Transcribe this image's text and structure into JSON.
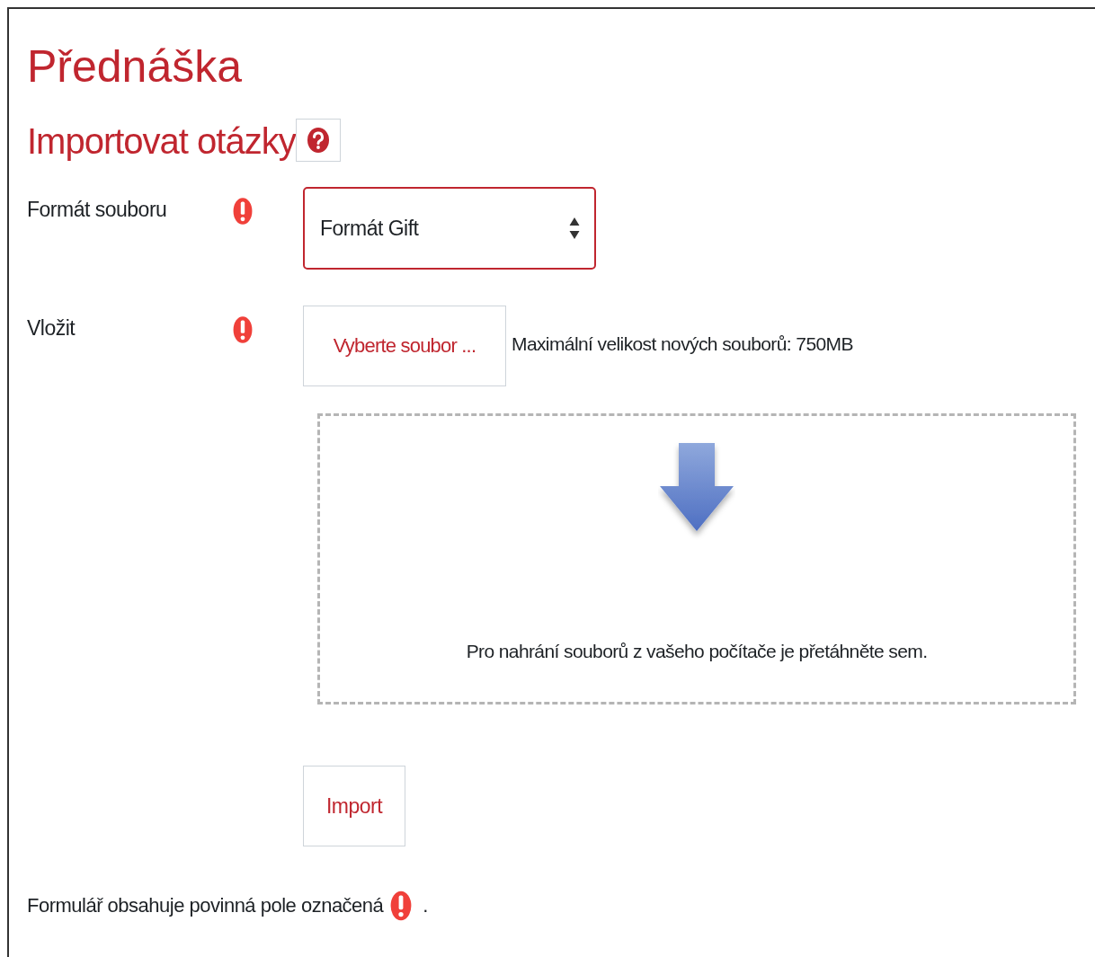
{
  "page_title": "Přednáška",
  "heading": {
    "text": "Importovat otázky",
    "help": true
  },
  "fields": [
    {
      "kind": "select",
      "label": "Formát souboru",
      "required": true,
      "value": "Formát Gift"
    },
    {
      "kind": "file",
      "label": "Vložit",
      "required": true,
      "button": "Vyberte soubor ...",
      "note": "Maximální velikost nových souborů: 750MB",
      "drop_text": "Pro nahrání souborů z vašeho počítače je přetáhněte sem."
    }
  ],
  "submit": "Import",
  "footer": {
    "text": "Formulář obsahuje povinná pole označená",
    "end": "."
  }
}
